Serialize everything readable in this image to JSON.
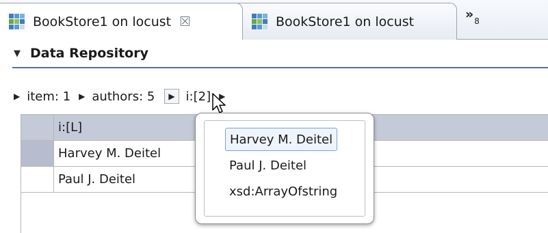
{
  "tabs": [
    {
      "label": "BookStore1 on locust",
      "close": "☒",
      "active": true,
      "icon": "cluster-icon"
    },
    {
      "label": "BookStore1 on locust",
      "active": false,
      "icon": "cluster-icon"
    }
  ],
  "overflow": {
    "symbol": "»",
    "count": "8"
  },
  "section": {
    "title": "Data Repository",
    "twisty": "▼"
  },
  "breadcrumb": [
    {
      "label": "item: 1"
    },
    {
      "label": "authors: 5"
    },
    {
      "label": "i:[2]"
    }
  ],
  "table": {
    "header": "i:[L]",
    "rows": [
      "Harvey M. Deitel",
      "Paul J. Deitel"
    ]
  },
  "popup": {
    "items": [
      "Harvey M. Deitel",
      "Paul J. Deitel",
      "xsd:ArrayOfstring"
    ],
    "selected_index": 0
  },
  "colors": {
    "accent_rule": "#55719c",
    "header_fill": "#c5cad9",
    "selection_border": "#7da2ce"
  }
}
